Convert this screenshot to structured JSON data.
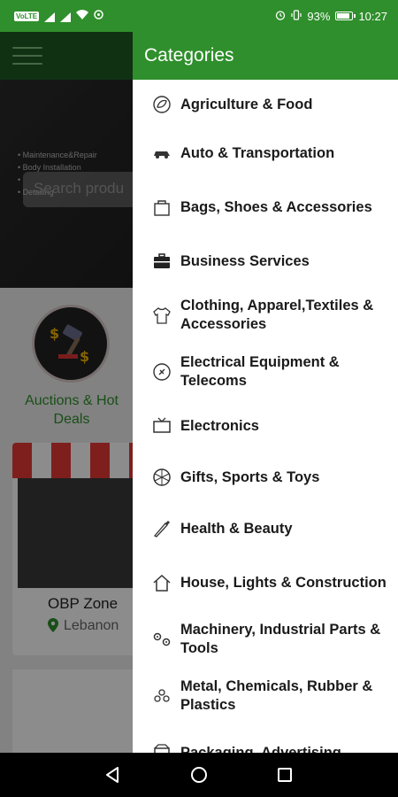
{
  "status_bar": {
    "volte_badge": "VoLTE",
    "battery_text": "93%",
    "battery_level": 0.93,
    "time": "10:27",
    "icons": [
      "signal-icon",
      "signal-icon",
      "wifi-icon",
      "dot-icon",
      "alarm-icon",
      "vibrate-icon",
      "battery-icon"
    ]
  },
  "background_app": {
    "banner_list": [
      "Maintenance&Repair",
      "Body Installation",
      "",
      "Detailing"
    ],
    "search_placeholder": "Search produ",
    "auction_label": "Auctions & Hot Deals",
    "store_name": "OBP Zone",
    "store_location": "Lebanon"
  },
  "drawer": {
    "title": "Categories",
    "categories": [
      {
        "label": "Agriculture & Food",
        "icon": "leaf-icon"
      },
      {
        "label": "Auto & Transportation",
        "icon": "car-icon"
      },
      {
        "label": "Bags, Shoes & Accessories",
        "icon": "bag-icon"
      },
      {
        "label": "Business Services",
        "icon": "briefcase-icon"
      },
      {
        "label": "Clothing, Apparel,Textiles & Accessories",
        "icon": "shirt-icon"
      },
      {
        "label": "Electrical Equipment & Telecoms",
        "icon": "plug-icon"
      },
      {
        "label": "Electronics",
        "icon": "tv-icon"
      },
      {
        "label": "Gifts, Sports & Toys",
        "icon": "ball-icon"
      },
      {
        "label": "Health & Beauty",
        "icon": "brush-icon"
      },
      {
        "label": "House, Lights & Construction",
        "icon": "house-icon"
      },
      {
        "label": "Machinery, Industrial Parts & Tools",
        "icon": "gear-icon"
      },
      {
        "label": "Metal, Chemicals, Rubber & Plastics",
        "icon": "pyramid-icon"
      },
      {
        "label": "Packaging, Advertising,",
        "icon": "box-icon"
      }
    ]
  },
  "nav_bar": {
    "buttons": [
      "back-icon",
      "home-icon",
      "recents-icon"
    ]
  },
  "colors": {
    "accent": "#2f8f2c",
    "header_dark": "#1f5a23"
  }
}
